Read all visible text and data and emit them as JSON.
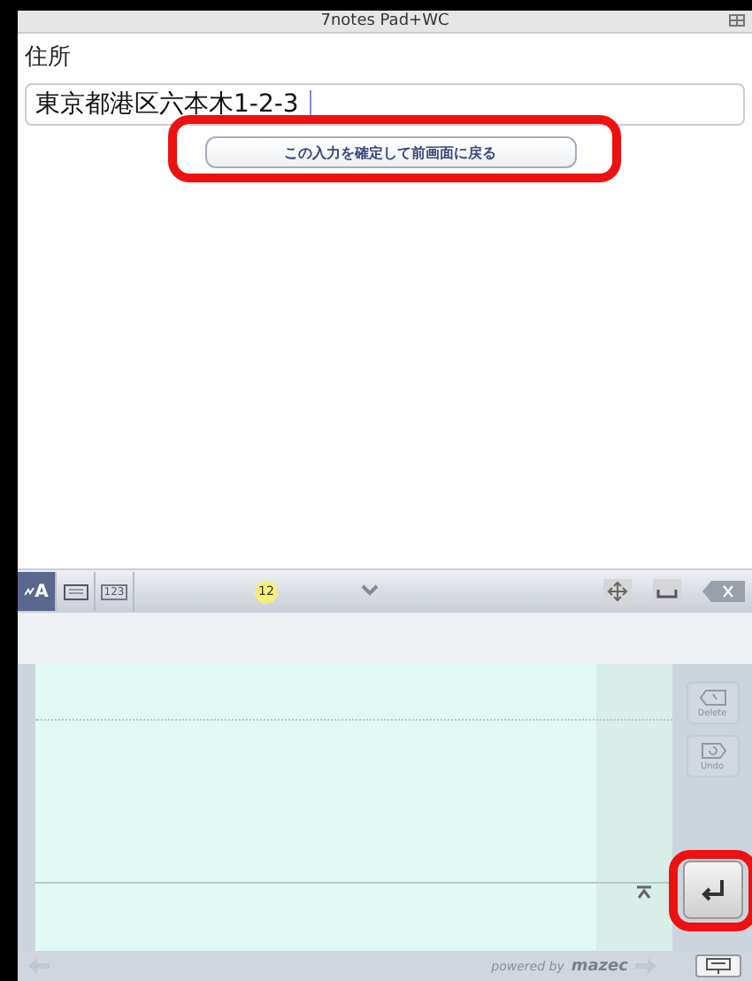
{
  "window": {
    "title": "7notes Pad+WC"
  },
  "form": {
    "label": "住所",
    "field": {
      "value": "東京都港区六本木1-2-3"
    },
    "confirm_button": "この入力を確定して前画面に戻る"
  },
  "toolbar": {
    "modes": [
      {
        "kind": "handwriting",
        "label": "A",
        "selected": true
      },
      {
        "kind": "keyboard",
        "selected": false
      },
      {
        "kind": "numeric",
        "label": "123",
        "selected": false
      }
    ],
    "badge": "12"
  },
  "side_buttons": [
    {
      "kind": "delete",
      "label": "Delete",
      "disabled": true
    },
    {
      "kind": "undo",
      "label": "Undo",
      "disabled": true
    }
  ],
  "footer": {
    "powered_by": "powered by",
    "brand": "mazec"
  }
}
